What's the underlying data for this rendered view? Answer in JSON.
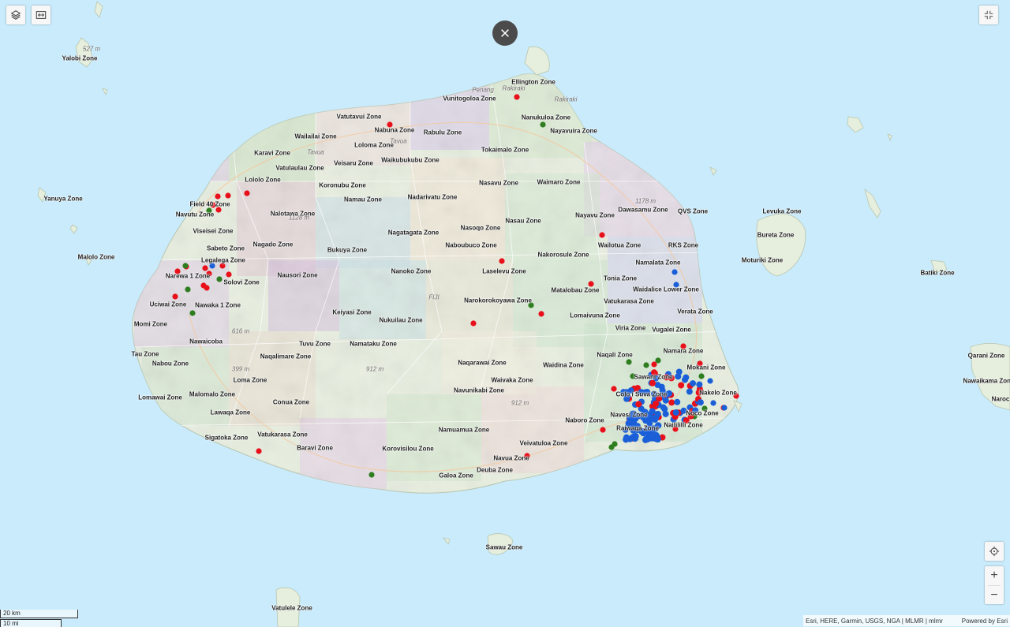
{
  "controls": {
    "layers_icon": "layers-icon",
    "swipe_icon": "swipe-icon",
    "close_icon": "close-icon",
    "fullscreen_icon": "fullscreen-exit-icon",
    "locate_icon": "locate-icon",
    "zoom_in_label": "+",
    "zoom_out_label": "−"
  },
  "colors": {
    "water": "#c9ebfb",
    "marker_red": "#e8101a",
    "marker_blue": "#1a5fd8",
    "marker_green": "#2e7d1f"
  },
  "zone_labels": [
    "Yalobi Zone",
    "Ellington Zone",
    "Vunitogoloa Zone",
    "Vatutavui Zone",
    "Nanukuloa Zone",
    "Nabuna Zone",
    "Rabulu Zone",
    "Nayavuira Zone",
    "Wailailai Zone",
    "Loloma Zone",
    "Tokaimalo Zone",
    "Karavi Zone",
    "Veisaru Zone",
    "Waikubukubu Zone",
    "Vatulaulau Zone",
    "Lololo Zone",
    "Nasavu Zone",
    "Waimaro Zone",
    "Koronubu Zone",
    "Yanuya Zone",
    "Field 40 Zone",
    "Namau Zone",
    "Nadarivatu Zone",
    "Navutu Zone",
    "Nalotawa Zone",
    "Dawasamu Zone",
    "QVS Zone",
    "Nayavu Zone",
    "Nasau Zone",
    "Levuka Zone",
    "Viseisei Zone",
    "Nagatagata Zone",
    "Nasoqo Zone",
    "Bureta Zone",
    "Nagado Zone",
    "Sabeto Zone",
    "Naboubuco Zone",
    "Wailotua Zone",
    "RKS Zone",
    "Malolo Zone",
    "Bukuya Zone",
    "Nakorosule Zone",
    "Moturiki Zone",
    "Legalega Zone",
    "Namalata Zone",
    "Nanoko Zone",
    "Laselevu Zone",
    "Batiki Zone",
    "Narewa 1 Zone",
    "Nausori Zone",
    "Solovi Zone",
    "Tonia Zone",
    "Matalobau Zone",
    "Waidalice Lower Zone",
    "Narokorokoyawa Zone",
    "Uciwai Zone",
    "Nawaka 1 Zone",
    "Vatukarasa Zone",
    "Keiyasi Zone",
    "Verata Zone",
    "Lomaivuna Zone",
    "Momi Zone",
    "Nukuilau Zone",
    "Viria Zone",
    "Vugalei Zone",
    "Nawaicoba",
    "Tuvu Zone",
    "Namataku Zone",
    "Namara Zone",
    "Tau Zone",
    "Naqali Zone",
    "Naqalimare Zone",
    "Qarani Zone",
    "Nabou Zone",
    "Naqarawai Zone",
    "Waidina Zone",
    "Mokani Zone",
    "Sawani Zone",
    "Loma Zone",
    "Waivaka Zone",
    "Nawaikama Zone",
    "Lomawai Zone",
    "Malomalo Zone",
    "Navunikabi Zone",
    "Colo i Suva Zone",
    "Nakelo Zone",
    "Naroc",
    "Conua Zone",
    "Lawaqa Zone",
    "Naboro Zone",
    "Navesi Zone",
    "Noco Zone",
    "Nailililli Zone",
    "Namuamua Zone",
    "Sigatoka Zone",
    "Vatukarasa Zone",
    "Raiwaqa Zone",
    "Veivatuloa Zone",
    "Baravi Zone",
    "Korovisilou Zone",
    "Navua Zone",
    "Deuba Zone",
    "Galoa Zone",
    "Sawau Zone",
    "Vatulele Zone"
  ],
  "place_labels": [
    "527 m",
    "Penang",
    "Rakiraki",
    "Tavua",
    "Tavua",
    "Rakiraki",
    "1128 m",
    "FIJI",
    "616 m",
    "399 m",
    "912 m",
    "912 m",
    "1178 m"
  ],
  "scale": {
    "km_label": "20 km",
    "mi_label": "10 mi"
  },
  "attribution": {
    "sources": "Esri, HERE, Garmin, USGS, NGA | MLMR | mlmr",
    "powered_by": "Powered by Esri"
  },
  "markers": {
    "red_count": 120,
    "blue_count": 60,
    "green_count": 22
  }
}
